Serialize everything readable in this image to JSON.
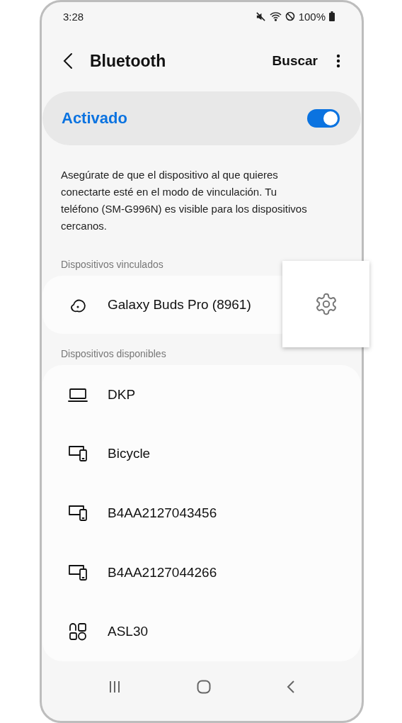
{
  "status_bar": {
    "time": "3:28",
    "battery": "100%"
  },
  "header": {
    "title": "Bluetooth",
    "action": "Buscar"
  },
  "master_switch": {
    "label": "Activado",
    "on": true
  },
  "description": "Asegúrate de que el dispositivo al que quieres conectarte esté en el modo de vinculación. Tu teléfono (SM-G996N) es visible para los dispositivos cercanos.",
  "paired": {
    "heading": "Dispositivos vinculados",
    "devices": [
      {
        "name": "Galaxy Buds Pro (8961)",
        "kind": "earbuds"
      }
    ]
  },
  "available": {
    "heading": "Dispositivos disponibles",
    "devices": [
      {
        "name": "DKP",
        "kind": "laptop"
      },
      {
        "name": "Bicycle",
        "kind": "multidevice"
      },
      {
        "name": "B4AA2127043456",
        "kind": "multidevice"
      },
      {
        "name": "B4AA2127044266",
        "kind": "multidevice"
      },
      {
        "name": "ASL30",
        "kind": "other"
      }
    ]
  }
}
